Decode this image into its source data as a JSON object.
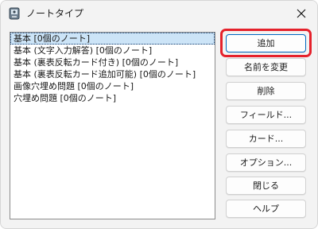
{
  "window": {
    "title": "ノートタイプ",
    "icon": "app-icon",
    "close_icon": "close-icon"
  },
  "list": {
    "items": [
      {
        "label": "基本 [0個のノート]",
        "selected": true
      },
      {
        "label": "基本 (文字入力解答) [0個のノート]",
        "selected": false
      },
      {
        "label": "基本 (裏表反転カード付き) [0個のノート]",
        "selected": false
      },
      {
        "label": "基本 (裏表反転カード追加可能) [0個のノート]",
        "selected": false
      },
      {
        "label": "画像穴埋め問題 [0個のノート]",
        "selected": false
      },
      {
        "label": "穴埋め問題 [0個のノート]",
        "selected": false
      }
    ]
  },
  "buttons": {
    "add": "追加",
    "rename": "名前を変更",
    "delete": "削除",
    "fields": "フィールド...",
    "cards": "カード...",
    "options": "オプション...",
    "close": "閉じる",
    "help": "ヘルプ"
  },
  "colors": {
    "selection": "#cce4f7",
    "highlight_outline": "#e5212b",
    "default_button_border": "#0067c0"
  }
}
